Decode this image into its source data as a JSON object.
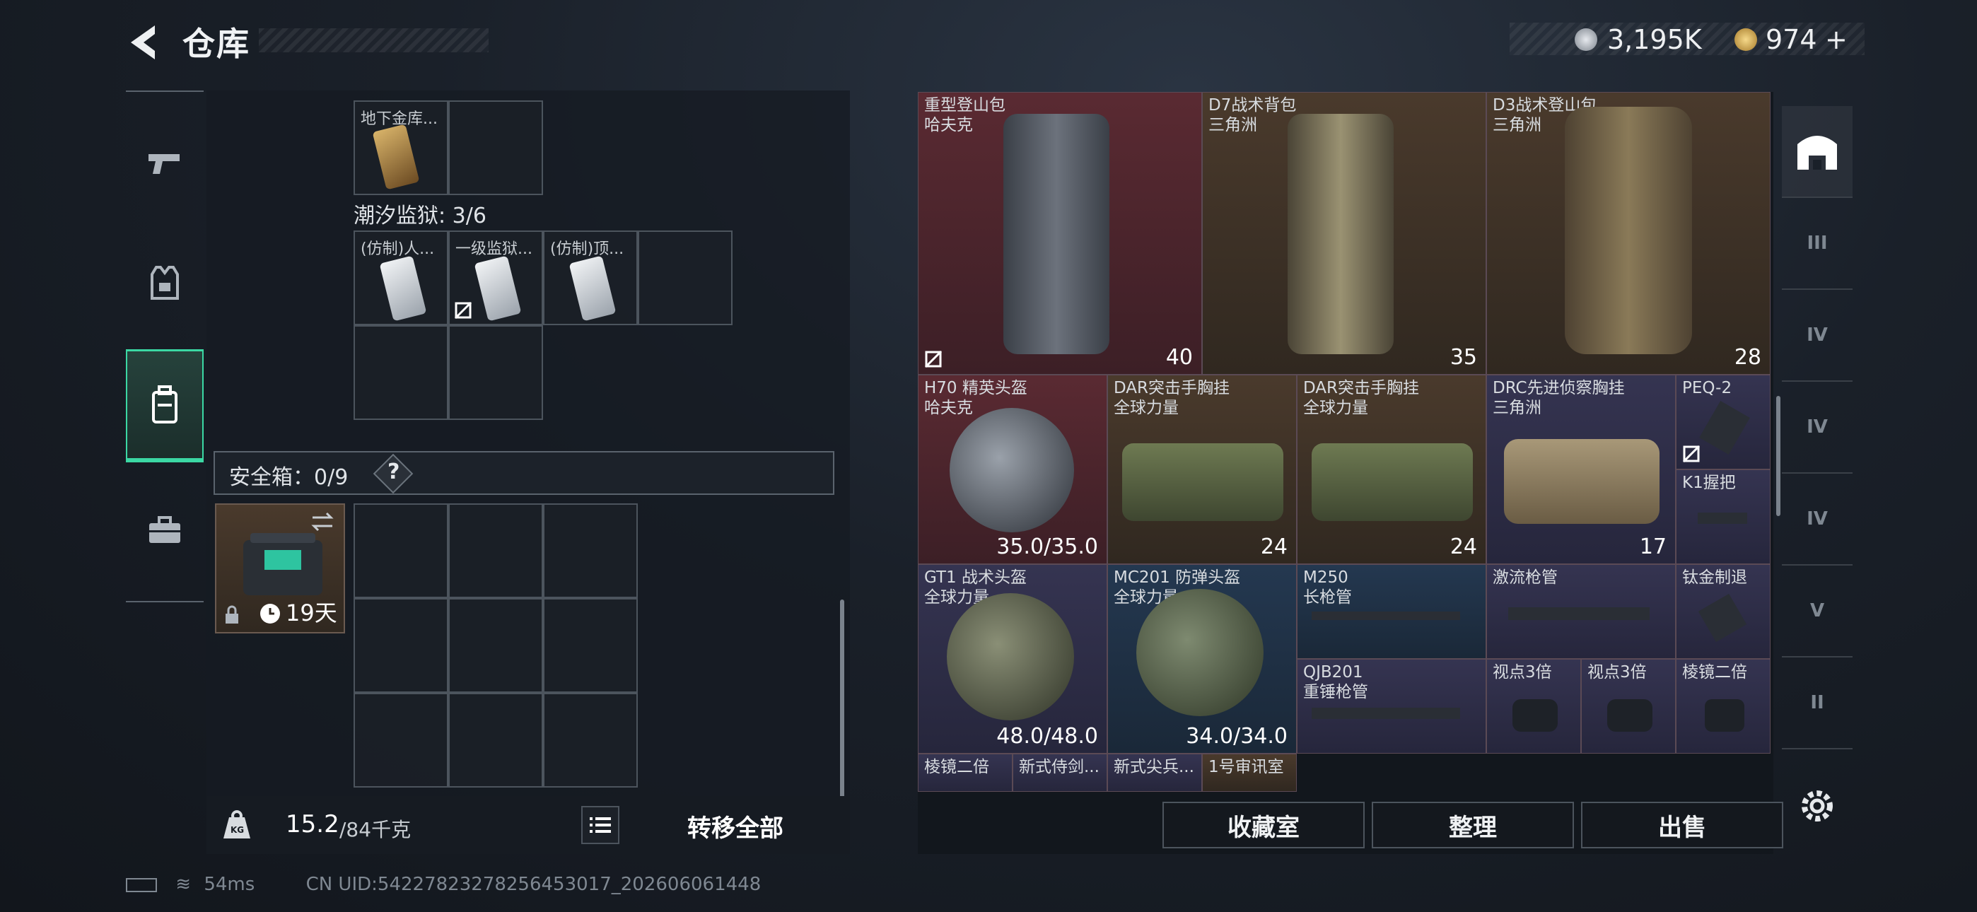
{
  "header": {
    "title": "仓库",
    "currency": [
      {
        "icon": "silver-coin-icon",
        "value": "3,195K"
      },
      {
        "icon": "gold-coin-icon",
        "value": "974"
      }
    ],
    "add_label": "+"
  },
  "left_panel": {
    "top_slots": [
      {
        "label": "地下金库..."
      }
    ],
    "section_title": "潮汐监狱: 3/6",
    "prison_cards": [
      {
        "label": "(仿制)人..."
      },
      {
        "label": "一级监狱..."
      },
      {
        "label": "(仿制)顶..."
      }
    ],
    "safe_box": {
      "label": "安全箱：0/9",
      "help": "?",
      "duration": "19天"
    },
    "weight": {
      "value": "15.2",
      "unit": "/84千克"
    },
    "transfer_all": "转移全部"
  },
  "items": [
    {
      "name": "重型登山包",
      "sub": "哈夫克",
      "qty": "40"
    },
    {
      "name": "D7战术背包",
      "sub": "三角洲",
      "qty": "35"
    },
    {
      "name": "D3战术登山包",
      "sub": "三角洲",
      "qty": "28"
    },
    {
      "name": "H70 精英头盔",
      "sub": "哈夫克",
      "qty": "35.0/35.0"
    },
    {
      "name": "DAR突击手胸挂",
      "sub": "全球力量",
      "qty": "24"
    },
    {
      "name": "DAR突击手胸挂",
      "sub": "全球力量",
      "qty": "24"
    },
    {
      "name": "DRC先进侦察胸挂",
      "sub": "三角洲",
      "qty": "17"
    },
    {
      "name": "PEQ-2",
      "sub": "",
      "qty": ""
    },
    {
      "name": "K1握把",
      "sub": "",
      "qty": ""
    },
    {
      "name": "GT1 战术头盔",
      "sub": "全球力量",
      "qty": "48.0/48.0"
    },
    {
      "name": "MC201 防弹头盔",
      "sub": "全球力量",
      "qty": "34.0/34.0"
    },
    {
      "name": "M250",
      "sub": "长枪管",
      "qty": ""
    },
    {
      "name": "激流枪管",
      "sub": "",
      "qty": ""
    },
    {
      "name": "钛金制退",
      "sub": "",
      "qty": ""
    },
    {
      "name": "QJB201",
      "sub": "重锤枪管",
      "qty": ""
    },
    {
      "name": "视点3倍",
      "sub": "",
      "qty": ""
    },
    {
      "name": "视点3倍",
      "sub": "",
      "qty": ""
    },
    {
      "name": "棱镜二倍",
      "sub": "",
      "qty": ""
    },
    {
      "name": "棱镜二倍",
      "sub": "",
      "qty": ""
    },
    {
      "name": "新式侍剑...",
      "sub": "",
      "qty": ""
    },
    {
      "name": "新式尖兵...",
      "sub": "",
      "qty": ""
    },
    {
      "name": "1号审讯室",
      "sub": "",
      "qty": ""
    }
  ],
  "actions": {
    "collection": "收藏室",
    "organize": "整理",
    "sell": "出售"
  },
  "right_nav": [
    "III",
    "IV",
    "IV",
    "IV",
    "V",
    "II"
  ],
  "status": {
    "ping": "54ms",
    "uid": "CN UID:5422782327825645301​7_202606061448"
  },
  "colors": {
    "accent": "#3bd8a4",
    "red_tier": "#5a2a32",
    "gold_tier": "#4a3a2c",
    "purple_tier": "#353451",
    "blue_tier": "#243850"
  }
}
